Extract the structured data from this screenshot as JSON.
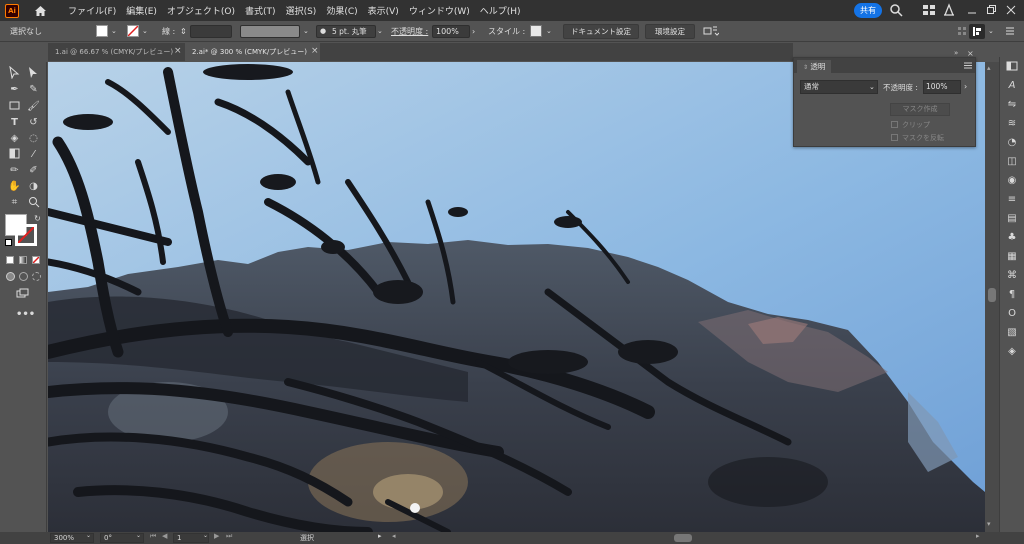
{
  "app": {
    "logo": "Ai",
    "icon_home": "home-icon"
  },
  "menu": [
    "ファイル(F)",
    "編集(E)",
    "オブジェクト(O)",
    "書式(T)",
    "選択(S)",
    "効果(C)",
    "表示(V)",
    "ウィンドウ(W)",
    "ヘルプ(H)"
  ],
  "share_label": "共有",
  "control": {
    "selection": "選択なし",
    "stroke_label": "線 :",
    "brush_value": "5 pt. 丸筆",
    "opacity_label": "不透明度 :",
    "opacity_value": "100%",
    "style_label": "スタイル :",
    "doc_settings": "ドキュメント設定",
    "prefs": "環境設定"
  },
  "tabs": [
    {
      "label": "1.ai @ 66.67 % (CMYK/プレビュー)"
    },
    {
      "label": "2.ai* @ 300 % (CMYK/プレビュー)"
    }
  ],
  "panel": {
    "close": "×",
    "tab": "透明",
    "blend_mode": "通常",
    "opacity_label": "不透明度 :",
    "opacity_value": "100%",
    "mask_button": "マスク作成",
    "clip_label": "クリップ",
    "invert_label": "マスクを反転"
  },
  "status": {
    "zoom": "300%",
    "rotation": "0°",
    "artboard": "1",
    "tool": "選択"
  },
  "colors": {
    "accent": "#1473e6",
    "menubar": "#323232",
    "workspace": "#535353",
    "sky": "#8fbbe0"
  }
}
